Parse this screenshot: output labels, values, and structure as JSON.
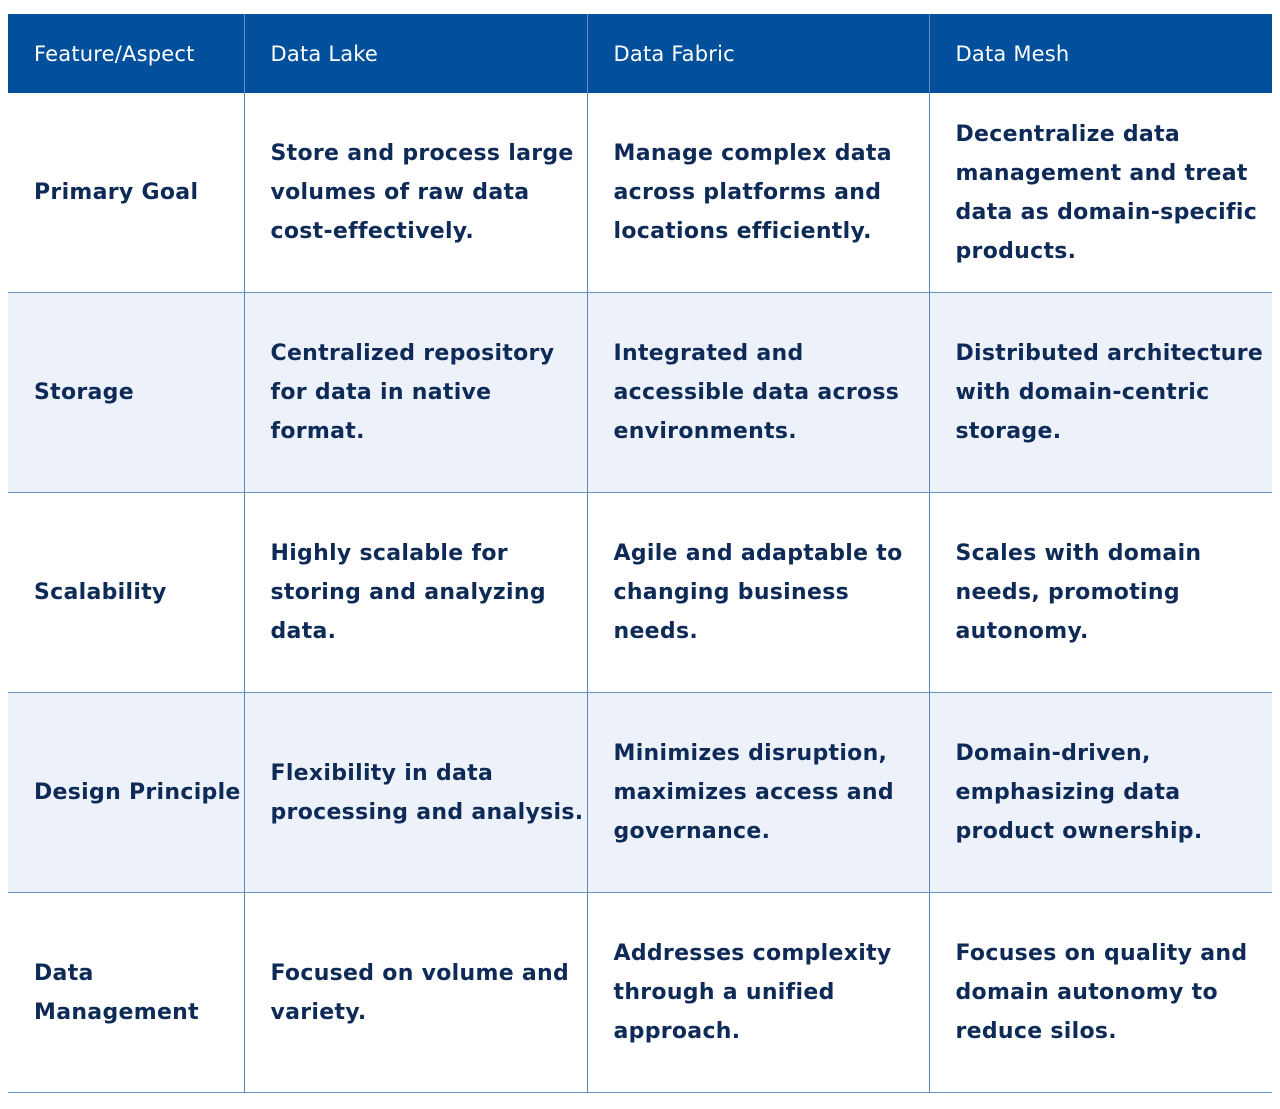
{
  "table": {
    "headers": [
      "Feature/Aspect",
      "Data Lake",
      "Data Fabric",
      "Data Mesh"
    ],
    "rows": [
      {
        "aspect": "Primary Goal",
        "data_lake": "Store and process large volumes of raw data cost-effectively.",
        "data_fabric": "Manage complex data across platforms and locations efficiently.",
        "data_mesh": "Decentralize data management and treat data as domain-specific products."
      },
      {
        "aspect": "Storage",
        "data_lake": "Centralized repository for data in native format.",
        "data_fabric": "Integrated and accessible data across environments.",
        "data_mesh": "Distributed architecture with domain-centric storage."
      },
      {
        "aspect": "Scalability",
        "data_lake": "Highly scalable for storing and analyzing data.",
        "data_fabric": "Agile and adaptable to changing business needs.",
        "data_mesh": "Scales with domain needs, promoting autonomy."
      },
      {
        "aspect": "Design Principle",
        "data_lake": "Flexibility in data processing and analysis.",
        "data_fabric": "Minimizes disruption, maximizes access and governance.",
        "data_mesh": "Domain-driven, emphasizing data product ownership."
      },
      {
        "aspect": "Data Management",
        "data_lake": "Focused on volume and variety.",
        "data_fabric": "Addresses complexity through a unified approach.",
        "data_mesh": "Focuses on quality and domain autonomy to reduce silos."
      }
    ]
  },
  "colors": {
    "header_bg": "#02509c",
    "header_text": "#ffffff",
    "body_text": "#0e2a57",
    "alt_row_bg": "#edf2fa",
    "grid_line": "#5b84b8"
  }
}
